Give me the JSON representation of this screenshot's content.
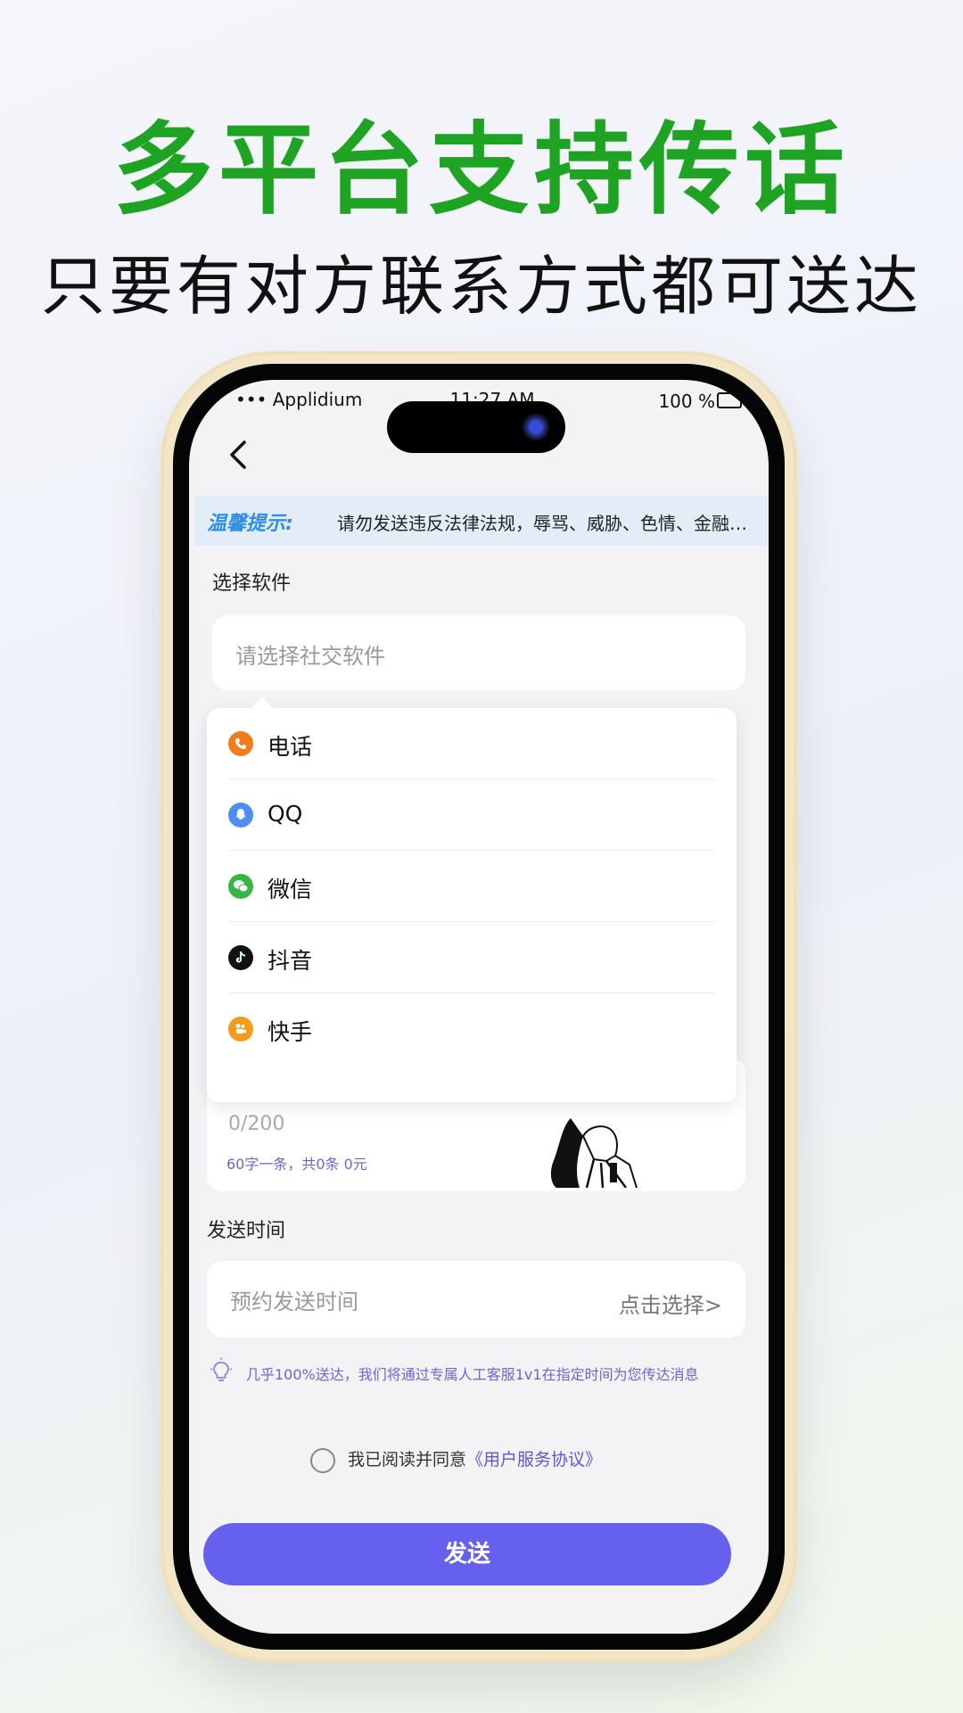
{
  "banner": {
    "headline": "多平台支持传话",
    "subline": "只要有对方联系方式都可送达"
  },
  "status_bar": {
    "carrier": "••• Applidium",
    "time": "11:27 AM",
    "battery": "100 %"
  },
  "notice": {
    "label": "温馨提示:",
    "text": "请勿发送违反法律法规，辱骂、威胁、色情、金融…"
  },
  "software": {
    "section_label": "选择软件",
    "placeholder": "请选择社交软件",
    "options": [
      {
        "label": "电话",
        "icon": "phone-icon",
        "color": "#f07c1e"
      },
      {
        "label": "QQ",
        "icon": "qq-icon",
        "color": "#4f8df5"
      },
      {
        "label": "微信",
        "icon": "wechat-icon",
        "color": "#38b547"
      },
      {
        "label": "抖音",
        "icon": "douyin-icon",
        "color": "#111111"
      },
      {
        "label": "快手",
        "icon": "kuaishou-icon",
        "color": "#f59a1b"
      }
    ]
  },
  "message": {
    "counter": "0/200",
    "price_info": "60字一条，共0条  0元"
  },
  "send_time": {
    "section_label": "发送时间",
    "placeholder": "预约发送时间",
    "action": "点击选择>"
  },
  "delivery_hint": "几乎100%送达，我们将通过专属人工客服1v1在指定时间为您传达消息",
  "agreement": {
    "prefix": "我已阅读并同意",
    "link": "《用户服务协议》"
  },
  "send_button": "发送",
  "colors": {
    "headline": "#1ea323",
    "accent": "#6660ef",
    "notice_bg": "#e3edf8",
    "link": "#5f56d8"
  }
}
